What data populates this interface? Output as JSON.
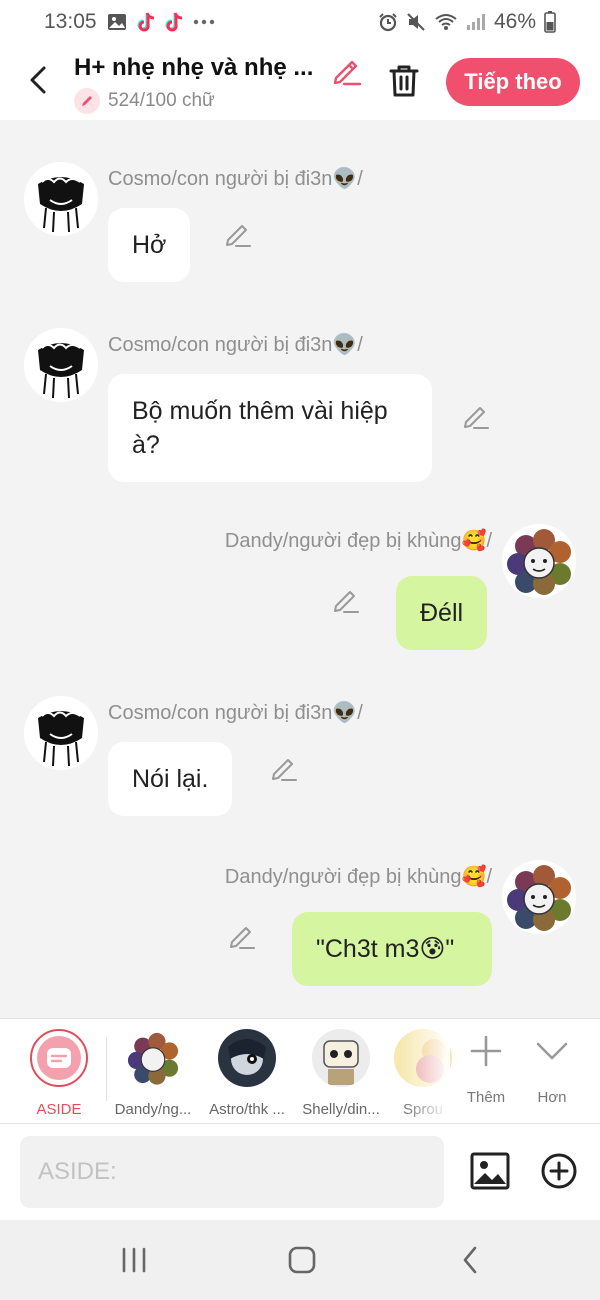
{
  "status_bar": {
    "time": "13:05",
    "battery": "46%"
  },
  "header": {
    "title": "H+ nhẹ nhẹ và nhẹ ...",
    "word_count": "524/100 chữ",
    "next_label": "Tiếp theo"
  },
  "messages": [
    {
      "side": "left",
      "name": "Cosmo/con người bị đi3n👽/",
      "text": "Hở"
    },
    {
      "side": "left",
      "name": "Cosmo/con người bị đi3n👽/",
      "text": "Bộ muốn thêm vài hiệp à?"
    },
    {
      "side": "right",
      "name": "Dandy/người đẹp bị khùng🥰/",
      "text": "Đéll"
    },
    {
      "side": "left",
      "name": "Cosmo/con người bị đi3n👽/",
      "text": "Nói lại."
    },
    {
      "side": "right",
      "name": "Dandy/người đẹp bị khùng🥰/",
      "text": "\"Ch3t m3😰\""
    }
  ],
  "characters": [
    {
      "label": "ASIDE"
    },
    {
      "label": "Dandy/ng..."
    },
    {
      "label": "Astro/thk ..."
    },
    {
      "label": "Shelly/din..."
    },
    {
      "label": "Sprou"
    }
  ],
  "tools": {
    "add_label": "Thêm",
    "more_label": "Hơn"
  },
  "input": {
    "placeholder": "ASIDE:"
  },
  "colors": {
    "accent": "#f0506e",
    "green_bubble": "#d6f5a0"
  }
}
